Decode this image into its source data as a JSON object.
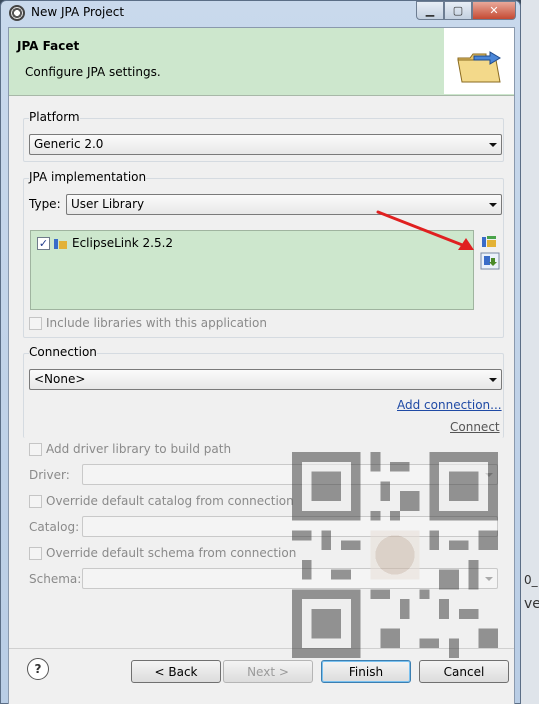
{
  "window": {
    "title": "New JPA Project",
    "minimize_glyph": "▁",
    "maximize_glyph": "▢",
    "close_glyph": "✕"
  },
  "header": {
    "title": "JPA Facet",
    "description": "Configure JPA settings.",
    "icon": "folder-with-arrow-icon"
  },
  "platform": {
    "group_label": "Platform",
    "selected": "Generic 2.0"
  },
  "jpa_implementation": {
    "group_label": "JPA implementation",
    "type_label": "Type:",
    "type_selected": "User Library",
    "libraries": [
      {
        "name": "EclipseLink 2.5.2",
        "checked": true
      }
    ],
    "include_libraries_label": "Include libraries with this application",
    "include_libraries_checked": false
  },
  "connection": {
    "group_label": "Connection",
    "selected": "<None>",
    "add_connection_link": "Add connection...",
    "connect_link": "Connect",
    "add_driver_label": "Add driver library to build path",
    "driver_label": "Driver:",
    "override_catalog_label": "Override default catalog from connection",
    "catalog_label": "Catalog:",
    "override_schema_label": "Override default schema from connection",
    "schema_label": "Schema:"
  },
  "buttons": {
    "help": "?",
    "back": "< Back",
    "next": "Next >",
    "finish": "Finish",
    "cancel": "Cancel"
  },
  "background_window": {
    "fragment_1": "0_",
    "fragment_2": "ve"
  },
  "colors": {
    "header_bg": "#cde7cd",
    "list_bg": "#cde7cd",
    "link": "#1f4aa5",
    "annotation_arrow": "#e02020"
  }
}
